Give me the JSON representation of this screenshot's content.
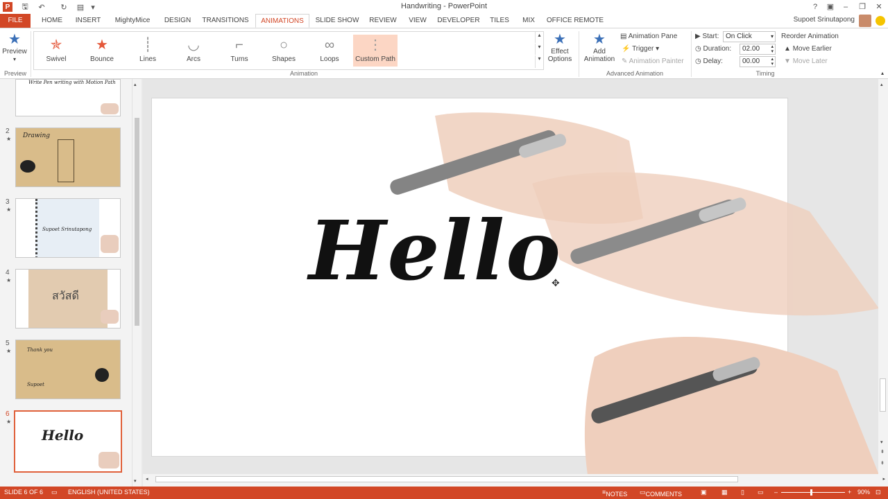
{
  "window": {
    "title": "Handwriting - PowerPoint",
    "user": "Supoet Srinutapong",
    "controls": [
      "?",
      "▣",
      "–",
      "❐",
      "✕"
    ]
  },
  "tabs": [
    "FILE",
    "HOME",
    "INSERT",
    "MightyMice",
    "DESIGN",
    "TRANSITIONS",
    "ANIMATIONS",
    "SLIDE SHOW",
    "REVIEW",
    "VIEW",
    "DEVELOPER",
    "TILES",
    "MIX",
    "OFFICE REMOTE"
  ],
  "active_tab": "ANIMATIONS",
  "ribbon": {
    "preview": {
      "label": "Preview",
      "group": "Preview"
    },
    "gallery": [
      "Swivel",
      "Bounce",
      "Lines",
      "Arcs",
      "Turns",
      "Shapes",
      "Loops",
      "Custom Path"
    ],
    "selected_effect": "Custom Path",
    "animation_group": "Animation",
    "effect_options": "Effect Options",
    "add_animation": "Add Animation",
    "animation_pane": "Animation Pane",
    "trigger": "Trigger",
    "animation_painter": "Animation Painter",
    "advanced_group": "Advanced Animation",
    "start_label": "Start:",
    "start_value": "On Click",
    "duration_label": "Duration:",
    "duration_value": "02.00",
    "delay_label": "Delay:",
    "delay_value": "00.00",
    "timing_group": "Timing",
    "reorder": "Reorder Animation",
    "move_earlier": "Move Earlier",
    "move_later": "Move Later"
  },
  "slides": [
    {
      "num": "",
      "text": "Write Pen writing with Motion Path"
    },
    {
      "num": "2",
      "text": "Drawing"
    },
    {
      "num": "3",
      "text": "Supoet Srinutapong"
    },
    {
      "num": "4",
      "text": "สวัสดี"
    },
    {
      "num": "5",
      "text": "Thank you",
      "text2": "Supoet"
    },
    {
      "num": "6",
      "text": "Hello"
    }
  ],
  "main_slide": {
    "text": "Hello"
  },
  "status": {
    "slide": "SLIDE 6 OF 6",
    "language": "ENGLISH (UNITED STATES)",
    "notes": "NOTES",
    "comments": "COMMENTS",
    "zoom": "90%"
  }
}
